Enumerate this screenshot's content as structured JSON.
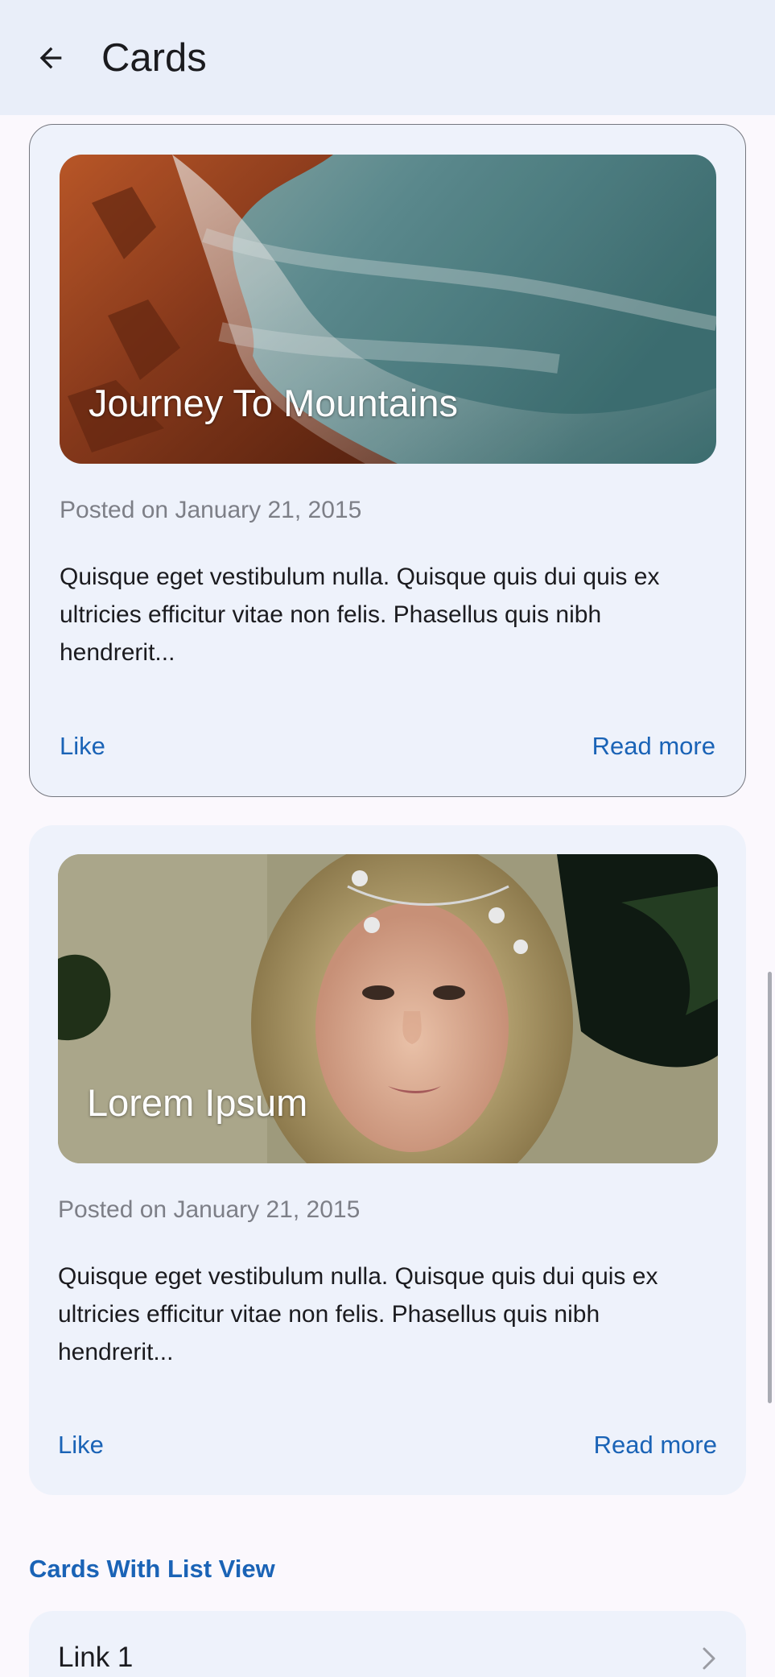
{
  "appbar": {
    "title": "Cards",
    "back_icon": "arrow-left-icon"
  },
  "cards": [
    {
      "image_title": "Journey To Mountains",
      "posted": "Posted on January 21, 2015",
      "body": "Quisque eget vestibulum nulla. Quisque quis dui quis ex ultricies efficitur vitae non felis. Phasellus quis nibh hendrerit...",
      "like_label": "Like",
      "read_more_label": "Read more"
    },
    {
      "image_title": "Lorem Ipsum",
      "posted": "Posted on January 21, 2015",
      "body": "Quisque eget vestibulum nulla. Quisque quis dui quis ex ultricies efficitur vitae non felis. Phasellus quis nibh hendrerit...",
      "like_label": "Like",
      "read_more_label": "Read more"
    }
  ],
  "list_section": {
    "title": "Cards With List View",
    "items": [
      {
        "label": "Link 1",
        "icon": "chevron-right-icon"
      }
    ]
  },
  "colors": {
    "accent": "#1a63b6",
    "appbar_bg": "#e9eef9",
    "card_bg": "#eef2fb",
    "page_bg": "#fbf8fd"
  }
}
